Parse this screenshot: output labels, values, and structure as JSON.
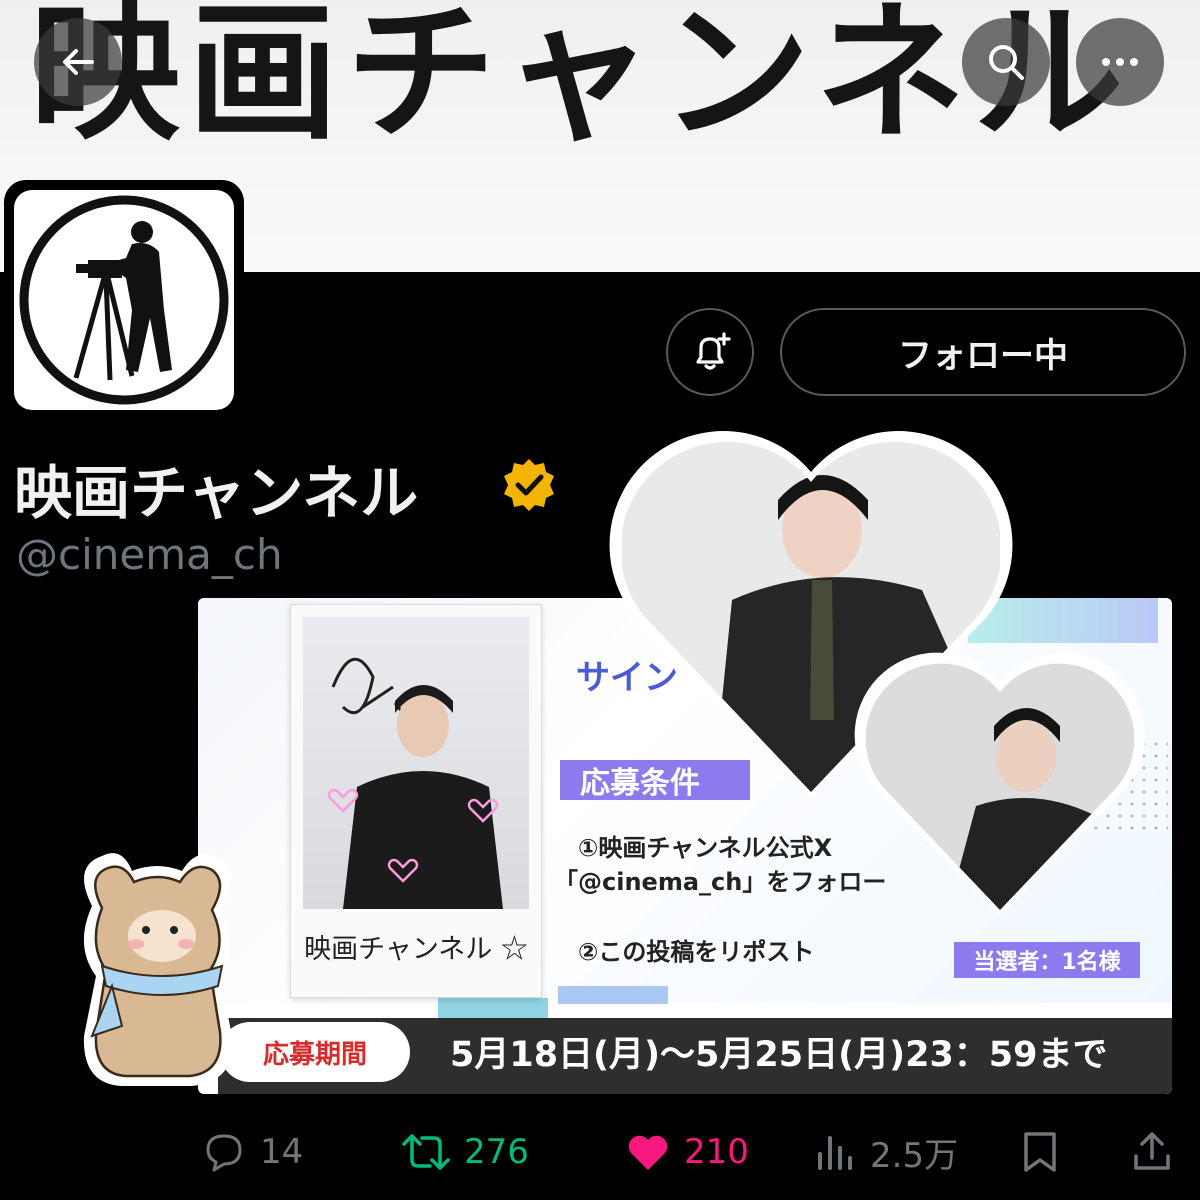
{
  "banner": {
    "title": "映画チャンネル"
  },
  "profile": {
    "name": "映画チャンネル",
    "handle": "@cinema_ch",
    "follow_label": "フォロー中",
    "verified_color": "#f4b400"
  },
  "promo": {
    "title": "サイン",
    "condition_tag": "応募条件",
    "conditions": [
      "①映画チャンネル公式X",
      "「@cinema_ch」をフォロー",
      "②この投稿をリポスト"
    ],
    "winner": "当選者：1名様",
    "period_label": "応募期間",
    "period": "5月18日(月)〜5月25日(月)23：59まで",
    "polaroid_caption": "映画チャンネル ☆"
  },
  "engagement": {
    "replies": "14",
    "reposts": "276",
    "likes": "210",
    "views": "2.5万",
    "repost_color": "#00ba7c",
    "like_color": "#f91880"
  },
  "icons": [
    "back-arrow-icon",
    "search-icon",
    "more-icon",
    "bell-plus-icon",
    "verified-badge-icon",
    "reply-icon",
    "repost-icon",
    "like-icon",
    "views-icon",
    "bookmark-icon",
    "share-icon"
  ]
}
